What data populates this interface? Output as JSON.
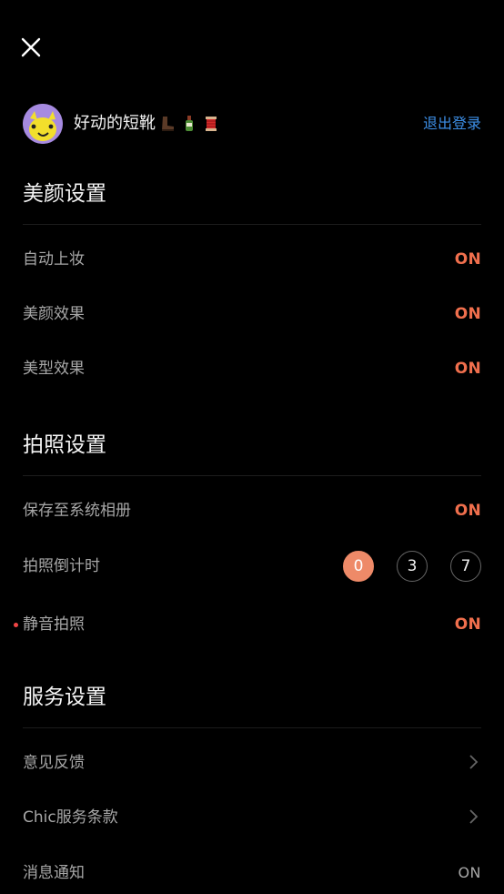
{
  "profile": {
    "username": "好动的短靴",
    "emojis": [
      "boot-emoji",
      "bottle-emoji",
      "spool-emoji"
    ],
    "logout_label": "退出登录"
  },
  "beauty": {
    "title": "美颜设置",
    "items": [
      {
        "label": "自动上妆",
        "value": "ON"
      },
      {
        "label": "美颜效果",
        "value": "ON"
      },
      {
        "label": "美型效果",
        "value": "ON"
      }
    ]
  },
  "photo": {
    "title": "拍照设置",
    "save_to_album": {
      "label": "保存至系统相册",
      "value": "ON"
    },
    "countdown": {
      "label": "拍照倒计时",
      "options": [
        "0",
        "3",
        "7"
      ],
      "selected": "0"
    },
    "silent": {
      "label": "静音拍照",
      "value": "ON"
    }
  },
  "service": {
    "title": "服务设置",
    "items": [
      {
        "label": "意见反馈"
      },
      {
        "label": "Chic服务条款"
      },
      {
        "label": "消息通知",
        "value": "ON"
      }
    ]
  },
  "colors": {
    "accent": "#f06f4d",
    "link": "#3d8fe7",
    "background": "#000000",
    "selected_circle": "#ee8a68"
  }
}
